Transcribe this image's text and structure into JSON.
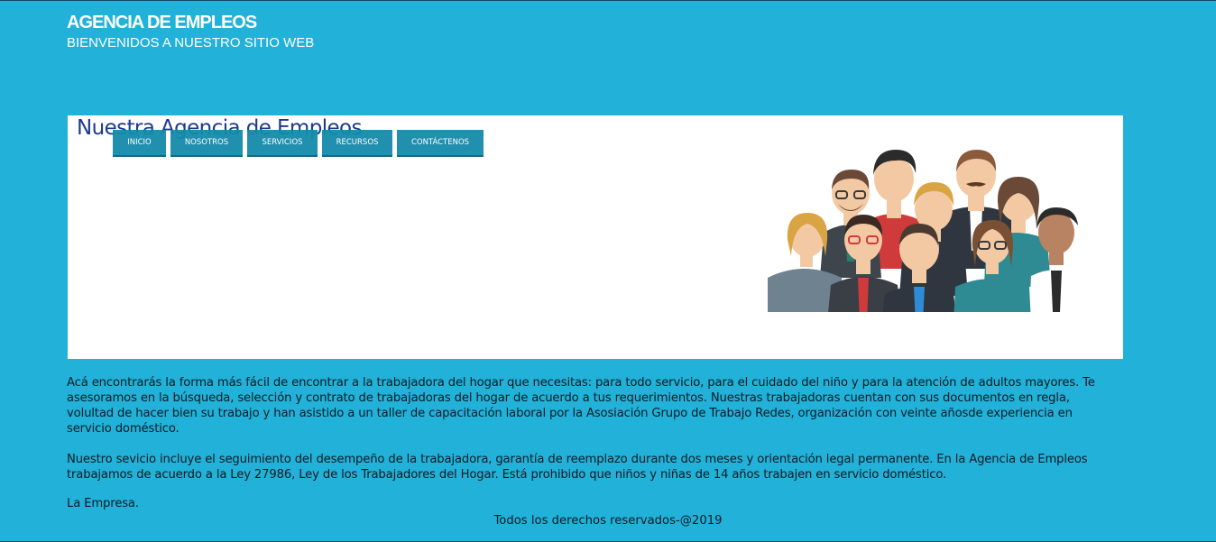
{
  "header": {
    "title": "AGENCIA DE EMPLEOS",
    "subtitle": "BIENVENIDOS A NUESTRO SITIO WEB"
  },
  "banner": {
    "title": "Nuestra Agencia de Empleos",
    "illustration_icon": "group-of-people-icon"
  },
  "nav": {
    "items": [
      {
        "label": "INICIO"
      },
      {
        "label": "NOSOTROS"
      },
      {
        "label": "SERVICIOS"
      },
      {
        "label": "RECURSOS"
      },
      {
        "label": "CONTÁCTENOS"
      }
    ]
  },
  "content": {
    "paragraph1": "Acá encontrarás la forma más fácil de encontrar a la trabajadora del hogar que necesitas: para todo servicio, para el cuidado del niño y para la atención de adultos mayores. Te asesoramos en la búsqueda, selección y contrato de trabajadoras del hogar de acuerdo a tus requerimientos. Nuestras trabajadoras cuentan con sus documentos en regla, volultad de hacer bien su trabajo y han asistido a un taller de capacitación laboral por la Asosiación Grupo de Trabajo Redes, organización con veinte añosde experiencia en servicio doméstico.",
    "paragraph2": "Nuestro sevicio incluye el seguimiento del desempeño de la trabajadora, garantía de reemplazo durante dos meses y orientación legal permanente. En la Agencia de Empleos trabajamos de acuerdo a la Ley 27986, Ley de los Trabajadores del Hogar. Está prohibido que niños y niñas de 14 años trabajen en servicio doméstico.",
    "signature": "La Empresa."
  },
  "footer": {
    "text": "Todos los derechos reservados-@2019"
  },
  "colors": {
    "background": "#21b1d9",
    "nav_button": "#168aaa",
    "banner_title": "#1c3a8f"
  }
}
